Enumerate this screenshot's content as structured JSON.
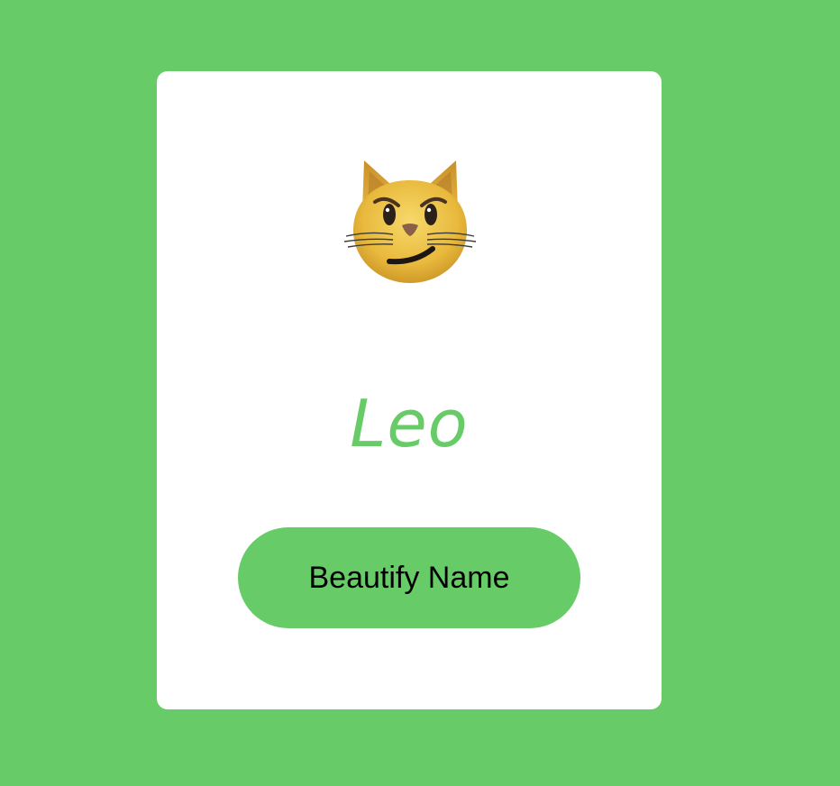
{
  "card": {
    "icon": "smirking-cat-icon",
    "name": "Leo",
    "button_label": "Beautify Name"
  },
  "colors": {
    "background": "#67cc67",
    "card": "#ffffff",
    "accent": "#67cc67",
    "button_text": "#000000"
  }
}
